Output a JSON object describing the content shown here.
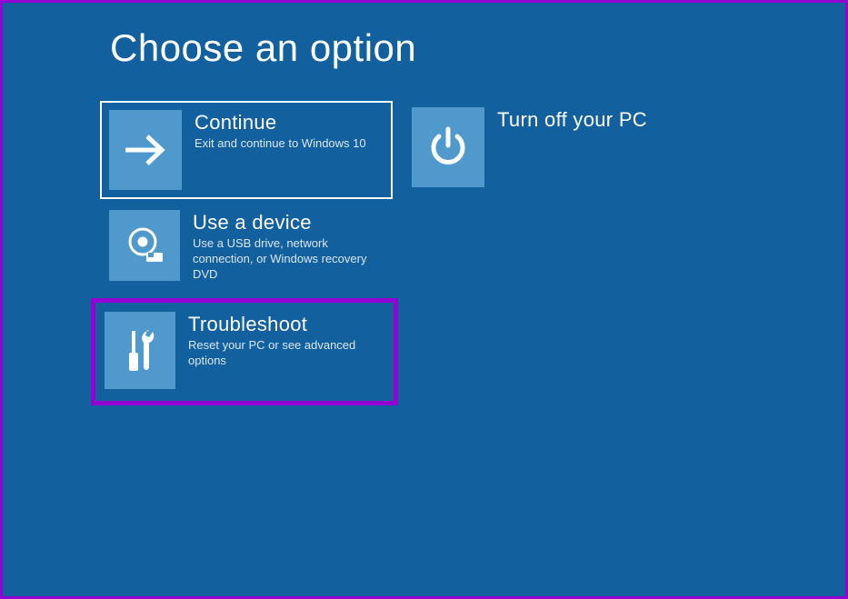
{
  "page_title": "Choose an option",
  "options": {
    "continue": {
      "title": "Continue",
      "description": "Exit and continue to Windows 10",
      "icon": "arrow-right-icon"
    },
    "use_device": {
      "title": "Use a device",
      "description": "Use a USB drive, network connection, or Windows recovery DVD",
      "icon": "disc-device-icon"
    },
    "troubleshoot": {
      "title": "Troubleshoot",
      "description": "Reset your PC or see advanced options",
      "icon": "tools-icon"
    },
    "poweroff": {
      "title": "Turn off your PC",
      "icon": "power-icon"
    }
  },
  "colors": {
    "background": "#13609e",
    "tile_icon_bg": "#4f99cc",
    "highlight_border": "#9400d3",
    "selected_border": "#ffffff"
  }
}
